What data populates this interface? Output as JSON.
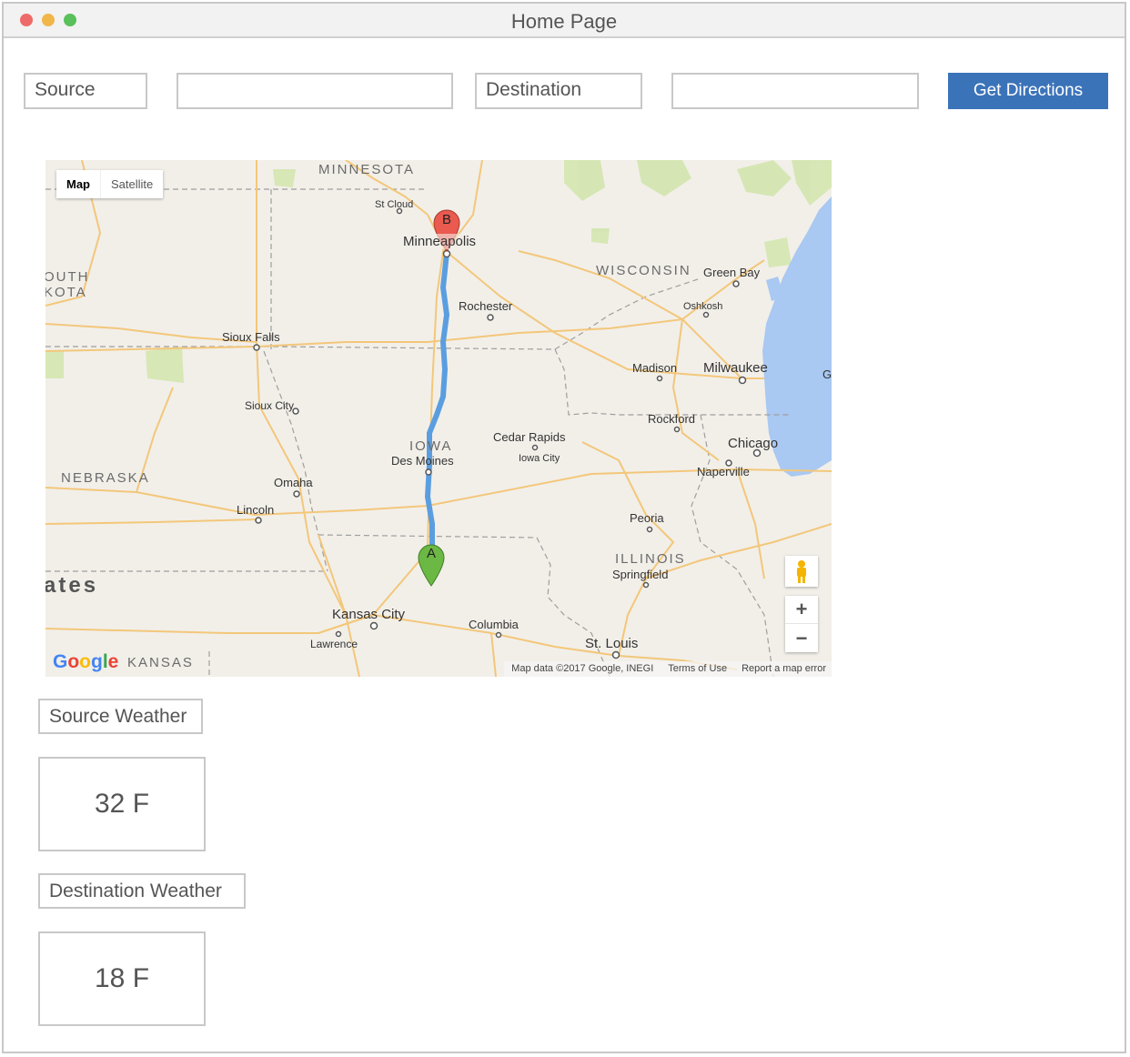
{
  "window": {
    "title": "Home Page",
    "controls": {
      "close_color": "#ee6a6a",
      "minimize_color": "#f0b64a",
      "maximize_color": "#5ac05a"
    }
  },
  "form": {
    "source_label": "Source",
    "source_value": "",
    "destination_label": "Destination",
    "destination_value": "",
    "submit_label": "Get Directions",
    "accent_color": "#3b73b9"
  },
  "map": {
    "type_buttons": [
      "Map",
      "Satellite"
    ],
    "selected_type": "Map",
    "marker_a": "A",
    "marker_b": "B",
    "route_color": "#5b9ee0",
    "zoom_in": "+",
    "zoom_out": "−",
    "logo": "Google",
    "attribution": "Map data ©2017 Google, INEGI",
    "terms": "Terms of Use",
    "report": "Report a map error",
    "places": [
      {
        "name": "MINNESOTA",
        "kind": "state"
      },
      {
        "name": "St Cloud",
        "kind": "city"
      },
      {
        "name": "Minneapolis",
        "kind": "city"
      },
      {
        "name": "OUTH",
        "kind": "state"
      },
      {
        "name": "KOTA",
        "kind": "state"
      },
      {
        "name": "WISCONSIN",
        "kind": "state"
      },
      {
        "name": "Green Bay",
        "kind": "city"
      },
      {
        "name": "Oshkosh",
        "kind": "city"
      },
      {
        "name": "Rochester",
        "kind": "city"
      },
      {
        "name": "Sioux Falls",
        "kind": "city"
      },
      {
        "name": "Madison",
        "kind": "city"
      },
      {
        "name": "Milwaukee",
        "kind": "city"
      },
      {
        "name": "G",
        "kind": "city"
      },
      {
        "name": "Sioux City",
        "kind": "city"
      },
      {
        "name": "Rockford",
        "kind": "city"
      },
      {
        "name": "IOWA",
        "kind": "state"
      },
      {
        "name": "Cedar Rapids",
        "kind": "city"
      },
      {
        "name": "Iowa City",
        "kind": "city"
      },
      {
        "name": "Des Moines",
        "kind": "city"
      },
      {
        "name": "Chicago",
        "kind": "city"
      },
      {
        "name": "Naperville",
        "kind": "city"
      },
      {
        "name": "NEBRASKA",
        "kind": "state"
      },
      {
        "name": "Omaha",
        "kind": "city"
      },
      {
        "name": "Lincoln",
        "kind": "city"
      },
      {
        "name": "Peoria",
        "kind": "city"
      },
      {
        "name": "ILLINOIS",
        "kind": "state"
      },
      {
        "name": "Springfield",
        "kind": "city"
      },
      {
        "name": "ates",
        "kind": "country"
      },
      {
        "name": "Kansas City",
        "kind": "city"
      },
      {
        "name": "Lawrence",
        "kind": "city"
      },
      {
        "name": "Columbia",
        "kind": "city"
      },
      {
        "name": "St. Louis",
        "kind": "city"
      },
      {
        "name": "KANSAS",
        "kind": "state"
      }
    ]
  },
  "weather": {
    "source_label": "Source Weather",
    "source_value": "32 F",
    "destination_label": "Destination Weather",
    "destination_value": "18 F"
  }
}
